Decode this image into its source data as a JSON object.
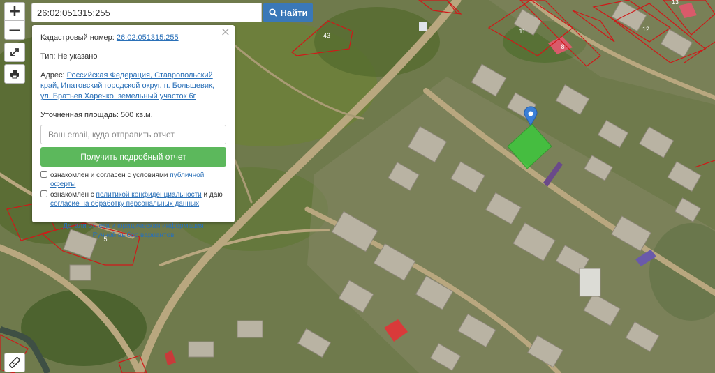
{
  "search": {
    "value": "26:02:051315:255",
    "button_label": "Найти"
  },
  "controls": {
    "zoom_in": "+",
    "zoom_out": "−"
  },
  "map": {
    "parcel_numbers": [
      "43",
      "11",
      "8",
      "12",
      "13",
      "5"
    ]
  },
  "panel": {
    "cadastral_label": "Кадастровый номер:",
    "cadastral_value": "26:02:051315:255",
    "type_label": "Тип:",
    "type_value": "Не указано",
    "address_label": "Адрес:",
    "address_value": "Российская Федерация, Ставропольский край, Ипатовский городской округ, п. Большевик, ул. Братьев Харечко, земельный участок 6г",
    "area_label": "Уточненная площадь:",
    "area_value": "500 кв.м.",
    "email_placeholder": "Ваш email, куда отправить отчет",
    "report_button": "Получить подробный отчет",
    "consent1_text": "ознакомлен и согласен с условиями ",
    "consent1_link": "публичной оферты",
    "consent2_text1": "ознакомлен с ",
    "consent2_link1": "политикой конфиденциальности",
    "consent2_text2": " и даю ",
    "consent2_link2": "согласие на обработку персональных данных",
    "link_details": "Детали отчета и юридическая информация",
    "link_manual": "Ручной выбор вариантов"
  }
}
